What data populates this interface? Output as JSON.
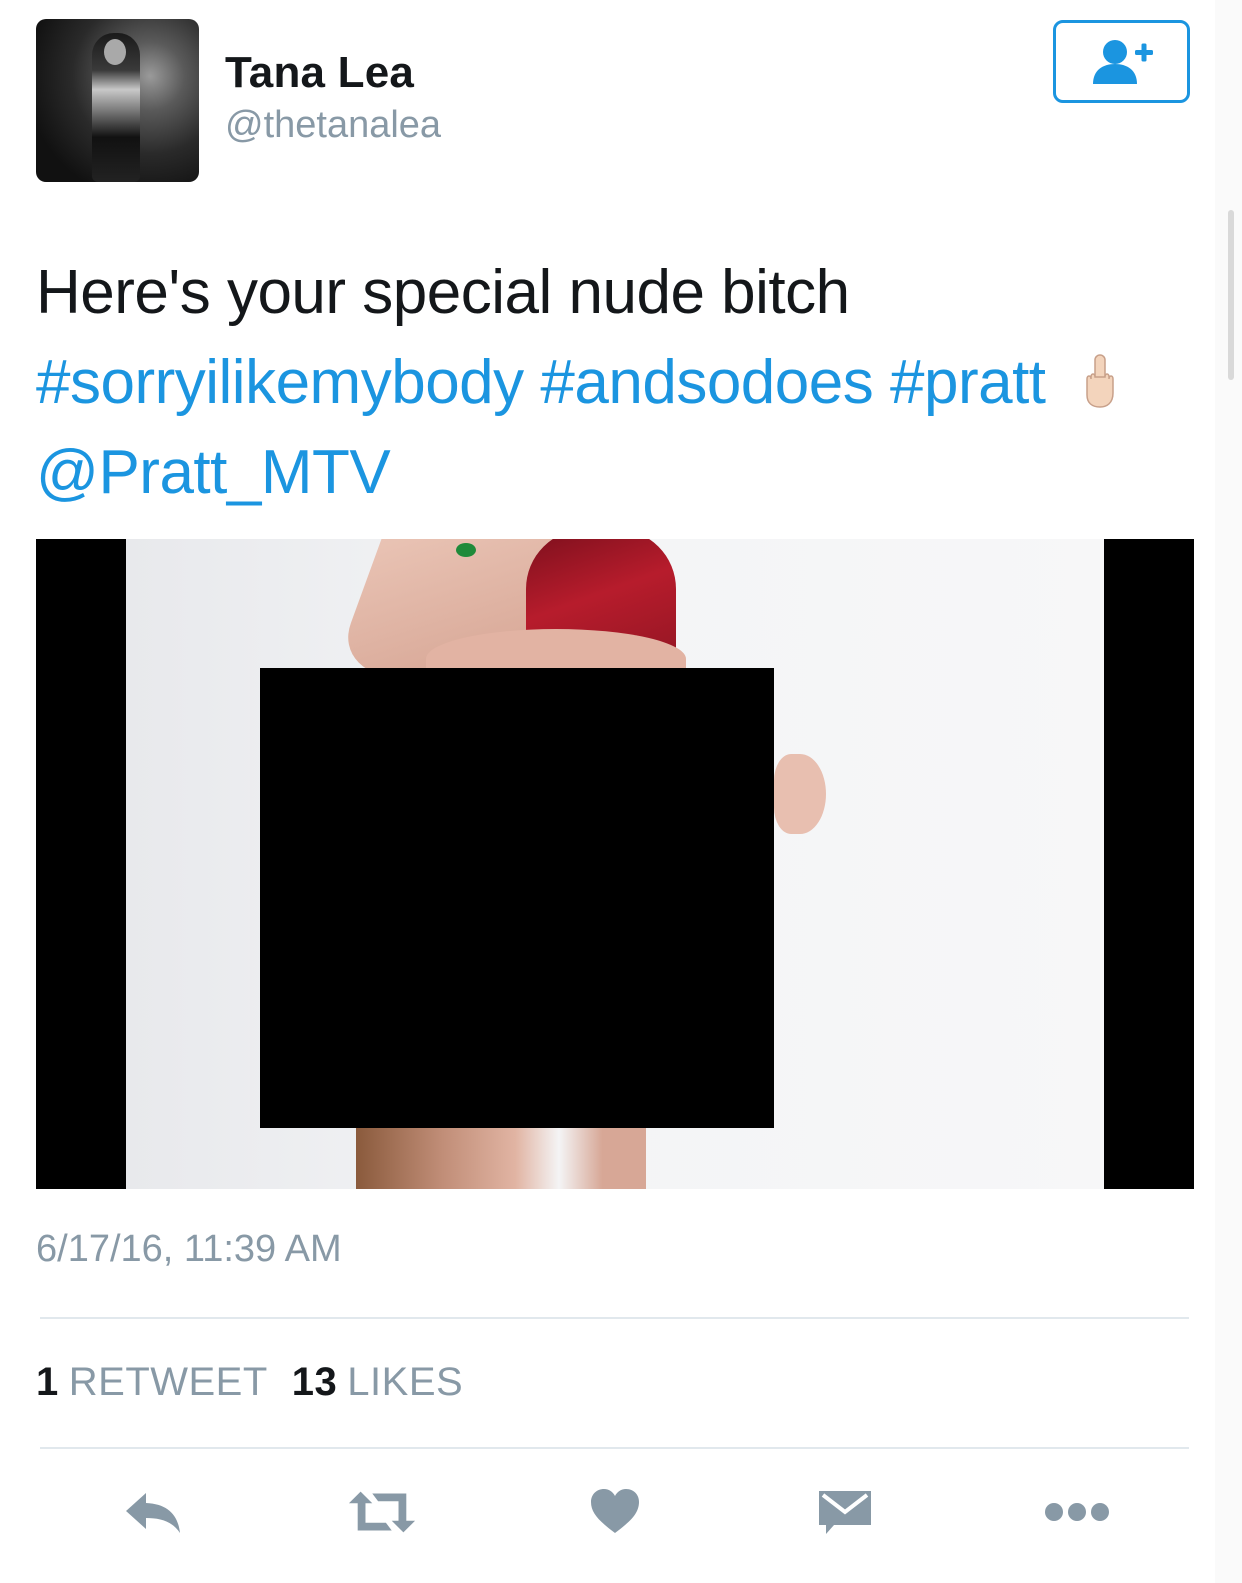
{
  "author": {
    "display_name": "Tana Lea",
    "handle": "@thetanalea"
  },
  "tweet": {
    "text_plain": "Here's your special nude bitch",
    "hashtags": [
      "#sorryilikemybody",
      "#andsodoes",
      "#pratt"
    ],
    "emoji": "middle-finger-light-skin-emoji",
    "mention": "@Pratt_MTV",
    "timestamp": "6/17/16, 11:39 AM"
  },
  "stats": {
    "retweets_count": "1",
    "retweets_label": "RETWEET",
    "likes_count": "13",
    "likes_label": "LIKES"
  },
  "icons": {
    "follow": "add-user-icon",
    "reply": "reply-icon",
    "retweet": "retweet-icon",
    "like": "heart-icon",
    "dm": "envelope-icon",
    "more": "more-icon"
  },
  "colors": {
    "link": "#1b95e0",
    "secondary_text": "#8899a6",
    "primary_text": "#14171a",
    "action_icon": "#8899a6"
  }
}
